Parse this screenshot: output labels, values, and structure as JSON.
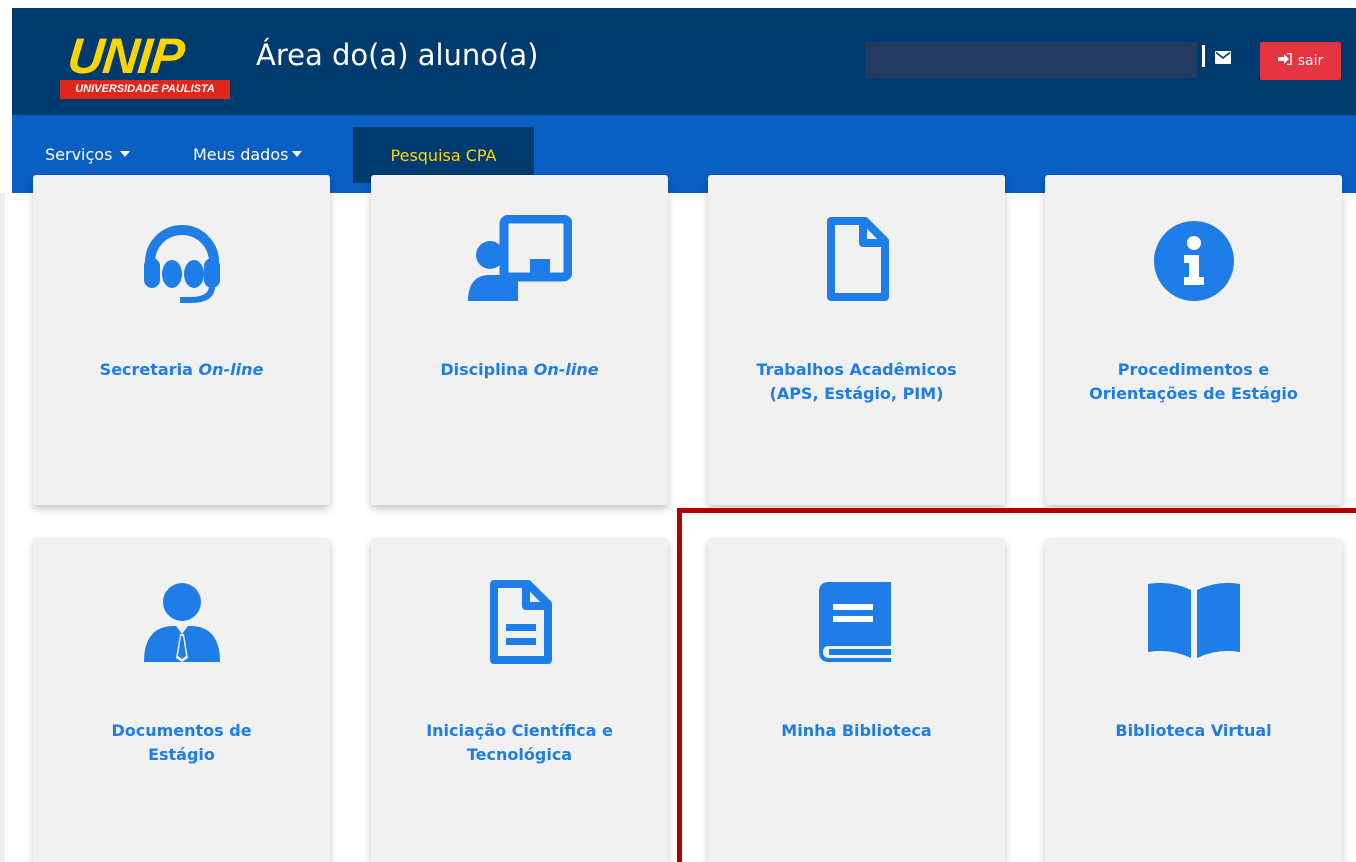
{
  "header": {
    "logo_main": "UNIP",
    "logo_tag": "UNIVERSIDADE PAULISTA",
    "title": "Área do(a) aluno(a)",
    "logout_label": "sair"
  },
  "nav": {
    "items": [
      {
        "label": "Serviços"
      },
      {
        "label": "Meus dados"
      }
    ],
    "cpa_label": "Pesquisa CPA"
  },
  "cards": [
    {
      "label_main": "Secretaria ",
      "label_italic": "On-line",
      "icon": "headset-icon"
    },
    {
      "label_main": "Disciplina ",
      "label_italic": "On-line",
      "icon": "presentation-icon"
    },
    {
      "line1": "Trabalhos Acadêmicos",
      "line2": "(APS, Estágio, PIM)",
      "icon": "document-icon"
    },
    {
      "line1": "Procedimentos e",
      "line2": "Orientações de Estágio",
      "icon": "info-icon"
    },
    {
      "line1": "Documentos de",
      "line2": "Estágio",
      "icon": "user-tie-icon"
    },
    {
      "line1": "Iniciação Científica e",
      "line2": "Tecnológica",
      "icon": "file-text-icon"
    },
    {
      "line1": "Minha Biblioteca",
      "icon": "book-icon"
    },
    {
      "line1": "Biblioteca Virtual",
      "icon": "open-book-icon"
    }
  ],
  "colors": {
    "header_bg": "#003b6f",
    "nav_bg": "#0a5fc2",
    "accent_yellow": "#ffd400",
    "card_text": "#1e7de6",
    "logout_red": "#e3343f",
    "highlight_red": "#b00000"
  }
}
